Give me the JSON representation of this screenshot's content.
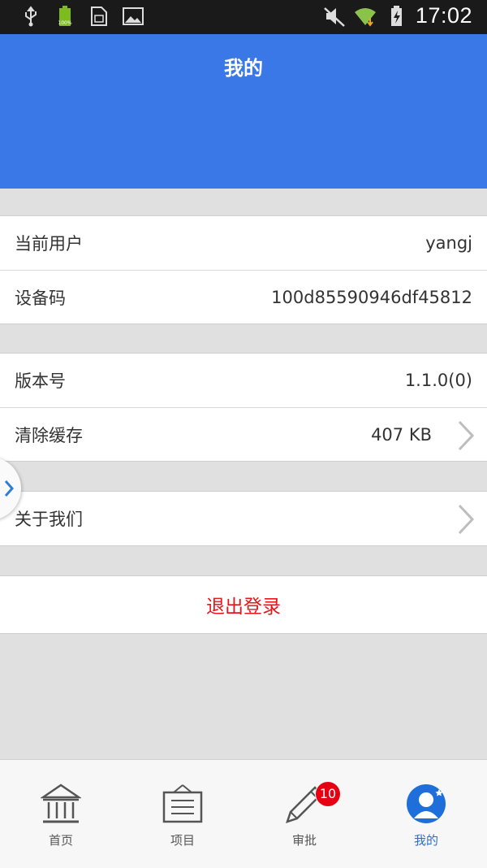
{
  "statusbar": {
    "time": "17:02",
    "battery_level": "100%",
    "icons": [
      "usb-icon",
      "battery-icon",
      "sim-icon",
      "image-icon",
      "mute-icon",
      "wifi-icon",
      "charging-battery-icon"
    ]
  },
  "header": {
    "title": "我的"
  },
  "group1": {
    "user_label": "当前用户",
    "user_value": "yangj",
    "device_label": "设备码",
    "device_value": "100d85590946df45812"
  },
  "group2": {
    "version_label": "版本号",
    "version_value": "1.1.0(0)",
    "cache_label": "清除缓存",
    "cache_value": "407 KB"
  },
  "group3": {
    "about_label": "关于我们"
  },
  "logout": {
    "label": "退出登录",
    "color": "#e8151b"
  },
  "nav": {
    "tabs": [
      {
        "label": "首页",
        "icon": "bank-icon"
      },
      {
        "label": "项目",
        "icon": "board-icon"
      },
      {
        "label": "审批",
        "icon": "pen-icon",
        "badge": "10"
      },
      {
        "label": "我的",
        "icon": "user-icon",
        "active": true
      }
    ]
  },
  "colors": {
    "header": "#3b78e7",
    "active_tab": "#2b6fd6",
    "badge": "#e60012"
  }
}
